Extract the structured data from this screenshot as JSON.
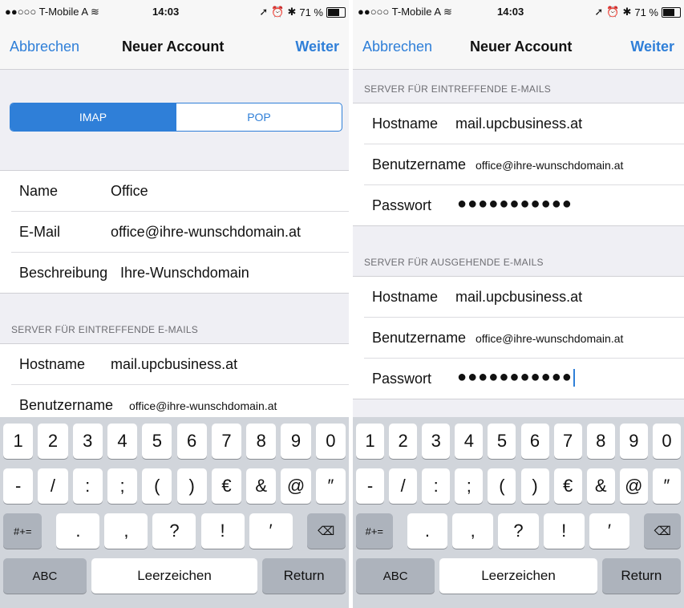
{
  "status_bar": {
    "carrier": "●●○○○ T-Mobile A",
    "wifi_icon": "wifi-icon",
    "time": "14:03",
    "battery_percent": "71 %"
  },
  "nav": {
    "cancel": "Abbrechen",
    "title": "Neuer Account",
    "next": "Weiter"
  },
  "left_screen": {
    "segment": {
      "imap": "IMAP",
      "pop": "POP",
      "selected": "IMAP"
    },
    "account": {
      "name_label": "Name",
      "name_value": "Office",
      "email_label": "E-Mail",
      "email_value": "office@ihre-wunschdomain.at",
      "description_label": "Beschreibung",
      "description_value": "Ihre-Wunschdomain"
    },
    "incoming_header": "SERVER FÜR EINTREFFENDE E-MAILS",
    "incoming": {
      "hostname_label": "Hostname",
      "hostname_value": "mail.upcbusiness.at",
      "username_label": "Benutzername",
      "username_value": "office@ihre-wunschdomain.at"
    }
  },
  "right_screen": {
    "incoming_header": "SERVER FÜR EINTREFFENDE E-MAILS",
    "incoming": {
      "hostname_label": "Hostname",
      "hostname_value": "mail.upcbusiness.at",
      "username_label": "Benutzername",
      "username_value": "office@ihre-wunschdomain.at",
      "password_label": "Passwort",
      "password_value": "●●●●●●●●●●●"
    },
    "outgoing_header": "SERVER FÜR AUSGEHENDE E-MAILS",
    "outgoing": {
      "hostname_label": "Hostname",
      "hostname_value": "mail.upcbusiness.at",
      "username_label": "Benutzername",
      "username_value": "office@ihre-wunschdomain.at",
      "password_label": "Passwort",
      "password_value": "●●●●●●●●●●●"
    }
  },
  "keyboard": {
    "row1": [
      "1",
      "2",
      "3",
      "4",
      "5",
      "6",
      "7",
      "8",
      "9",
      "0"
    ],
    "row2": [
      "-",
      "/",
      ":",
      ";",
      "(",
      ")",
      "€",
      "&",
      "@",
      "″"
    ],
    "row3": [
      ".",
      ",",
      "?",
      "!",
      "′"
    ],
    "symbols": "#+=",
    "backspace_icon": "backspace-icon",
    "abc": "ABC",
    "space": "Leerzeichen",
    "return": "Return"
  },
  "colors": {
    "accent": "#2f7fd8",
    "background": "#efeff4"
  }
}
